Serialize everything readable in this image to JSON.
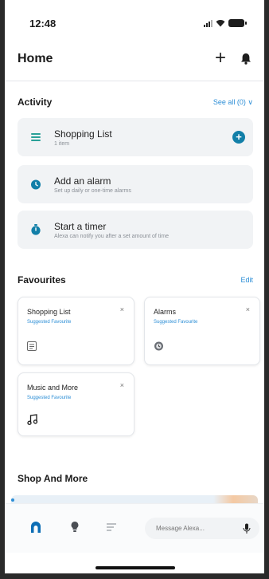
{
  "status_bar": {
    "time": "12:48"
  },
  "header": {
    "title": "Home",
    "plus_icon": "plus-icon",
    "bell_icon": "bell-icon"
  },
  "activity": {
    "title": "Activity",
    "link": "See all (0) ∨",
    "items": [
      {
        "title": "Shopping List",
        "subtitle": "1 item",
        "icon": "list-icon"
      },
      {
        "title": "Add an alarm",
        "subtitle": "Set up daily or one-time alarms",
        "icon": "alarm-icon"
      },
      {
        "title": "Start a timer",
        "subtitle": "Alexa can notify you after a set amount of time",
        "icon": "timer-icon"
      }
    ]
  },
  "favourites": {
    "title": "Favourites",
    "link": "Edit",
    "items": [
      {
        "title": "Shopping List",
        "subtitle": "Suggested Favourite",
        "remove": "×",
        "icon": "list-icon"
      },
      {
        "title": "Alarms",
        "subtitle": "Suggested Favourite",
        "remove": "×",
        "icon": "alarm-icon"
      },
      {
        "title": "Music and More",
        "subtitle": "Suggested Favourite",
        "remove": "×",
        "icon": "music-note-icon"
      }
    ]
  },
  "shop": {
    "title": "Shop And More"
  },
  "bottom_nav": {
    "home_icon": "home-icon",
    "devices_icon": "lightbulb-icon",
    "more_icon": "menu-icon",
    "message_placeholder": "Message Alexa...",
    "mic_icon": "mic-icon"
  },
  "colors": {
    "accent": "#127fa8",
    "link": "#2c8ed6",
    "card_bg": "#f1f3f5",
    "home_active": "#0d6eb5"
  }
}
